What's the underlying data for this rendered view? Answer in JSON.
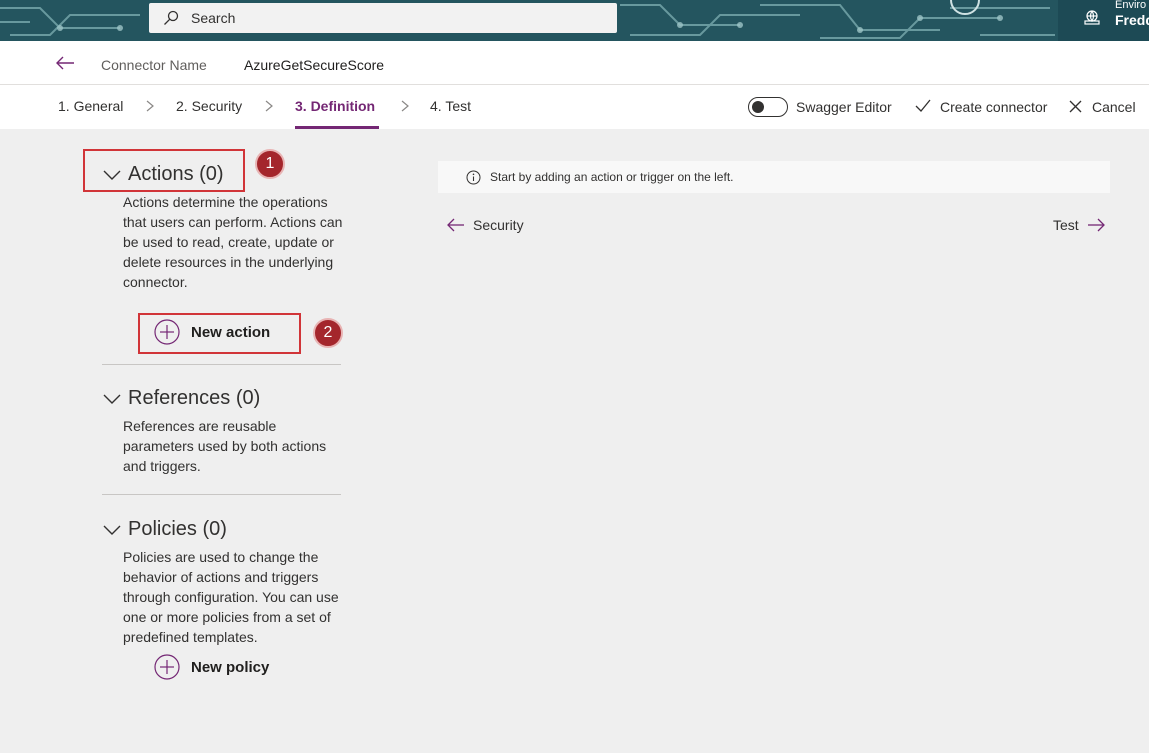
{
  "search": {
    "placeholder": "Search"
  },
  "environment": {
    "label": "Enviro",
    "name": "Fredd"
  },
  "header": {
    "connector_label": "Connector Name",
    "connector_value": "AzureGetSecureScore"
  },
  "tabs": [
    {
      "label": "1. General"
    },
    {
      "label": "2. Security"
    },
    {
      "label": "3. Definition"
    },
    {
      "label": "4. Test"
    }
  ],
  "toolbar": {
    "swagger_label": "Swagger Editor",
    "create_label": "Create connector",
    "cancel_label": "Cancel"
  },
  "sections": {
    "actions": {
      "title": "Actions (0)",
      "description": "Actions determine the operations that users can perform. Actions can be used to read, create, update or delete resources in the underlying connector.",
      "button": "New action"
    },
    "references": {
      "title": "References (0)",
      "description": "References are reusable parameters used by both actions and triggers."
    },
    "policies": {
      "title": "Policies (0)",
      "description": "Policies are used to change the behavior of actions and triggers through configuration. You can use one or more policies from a set of predefined templates.",
      "button": "New policy"
    }
  },
  "annotations": {
    "badge1": "1",
    "badge2": "2"
  },
  "info": {
    "text": "Start by adding an action or trigger on the left."
  },
  "navigation": {
    "prev": "Security",
    "next": "Test"
  },
  "colors": {
    "accent": "#742774",
    "annotation_red": "#d13438",
    "badge": "#a4262c"
  }
}
